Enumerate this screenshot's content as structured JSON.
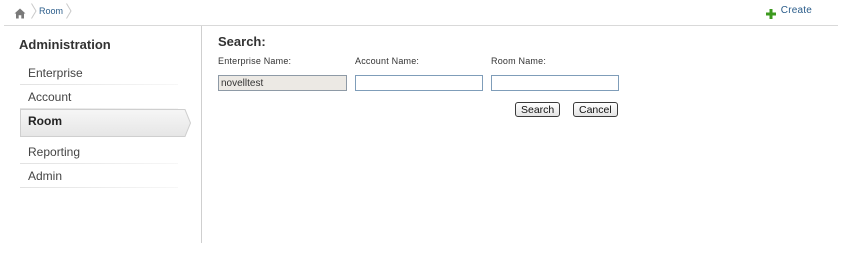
{
  "breadcrumb": {
    "home_icon": "home-icon",
    "current": "Room"
  },
  "toolbar": {
    "create_label": "Create",
    "create_icon": "plus-icon",
    "create_icon_color": "#3d9a1f"
  },
  "sidebar": {
    "title": "Administration",
    "items": [
      {
        "label": "Enterprise",
        "active": false
      },
      {
        "label": "Account",
        "active": false
      },
      {
        "label": "Room",
        "active": true
      },
      {
        "label": "Reporting",
        "active": false
      },
      {
        "label": "Admin",
        "active": false
      }
    ]
  },
  "search": {
    "title": "Search:",
    "fields": [
      {
        "label": "Enterprise Name:",
        "value": "novelltest",
        "placeholder": "",
        "disabled": true
      },
      {
        "label": "Account Name:",
        "value": "",
        "placeholder": "",
        "disabled": false
      },
      {
        "label": "Room Name:",
        "value": "",
        "placeholder": "",
        "disabled": false
      }
    ],
    "search_button": "Search",
    "cancel_button": "Cancel"
  },
  "colors": {
    "link": "#2a5c8a",
    "border": "#7f9db9",
    "disabled_bg": "#ece9e4"
  }
}
